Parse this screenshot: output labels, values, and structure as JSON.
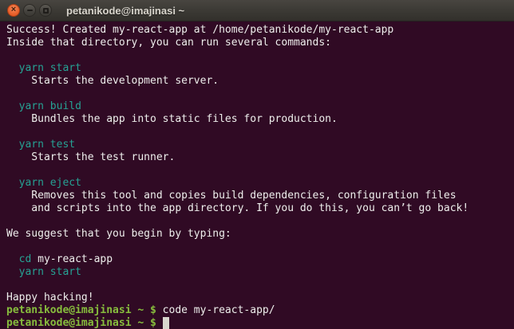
{
  "window": {
    "title": "petanikode@imajinasi ~",
    "icons": {
      "close": "×",
      "minimize": "minimize-bar",
      "maximize": "maximize-square"
    }
  },
  "colors": {
    "terminal_background": "#300a24",
    "foreground": "#eeeeec",
    "command_teal": "#26a294",
    "prompt_green": "#87bd3d",
    "titlebar": "#3b3934",
    "close_button": "#e8612c",
    "cursor": "#d8d6cd"
  },
  "terminal": {
    "lines": [
      [
        {
          "t": "Success! Created my-react-app at /home/petanikode/my-react-app",
          "c": "fg"
        }
      ],
      [
        {
          "t": "Inside that directory, you can run several commands:",
          "c": "fg"
        }
      ],
      [],
      [
        {
          "t": "  yarn start",
          "c": "teal"
        }
      ],
      [
        {
          "t": "    Starts the development server.",
          "c": "fg"
        }
      ],
      [],
      [
        {
          "t": "  yarn build",
          "c": "teal"
        }
      ],
      [
        {
          "t": "    Bundles the app into static files for production.",
          "c": "fg"
        }
      ],
      [],
      [
        {
          "t": "  yarn test",
          "c": "teal"
        }
      ],
      [
        {
          "t": "    Starts the test runner.",
          "c": "fg"
        }
      ],
      [],
      [
        {
          "t": "  yarn eject",
          "c": "teal"
        }
      ],
      [
        {
          "t": "    Removes this tool and copies build dependencies, configuration files",
          "c": "fg"
        }
      ],
      [
        {
          "t": "    and scripts into the app directory. If you do this, you can’t go back!",
          "c": "fg"
        }
      ],
      [],
      [
        {
          "t": "We suggest that you begin by typing:",
          "c": "fg"
        }
      ],
      [],
      [
        {
          "t": "  cd",
          "c": "teal"
        },
        {
          "t": " my-react-app",
          "c": "fg"
        }
      ],
      [
        {
          "t": "  yarn start",
          "c": "teal"
        }
      ],
      [],
      [
        {
          "t": "Happy hacking!",
          "c": "fg"
        }
      ],
      [
        {
          "t": "petanikode@imajinasi ~ $",
          "c": "green"
        },
        {
          "t": " code my-react-app/",
          "c": "fg"
        }
      ],
      [
        {
          "t": "petanikode@imajinasi ~ $ ",
          "c": "green"
        },
        {
          "t": " ",
          "c": "cursor"
        }
      ]
    ]
  }
}
